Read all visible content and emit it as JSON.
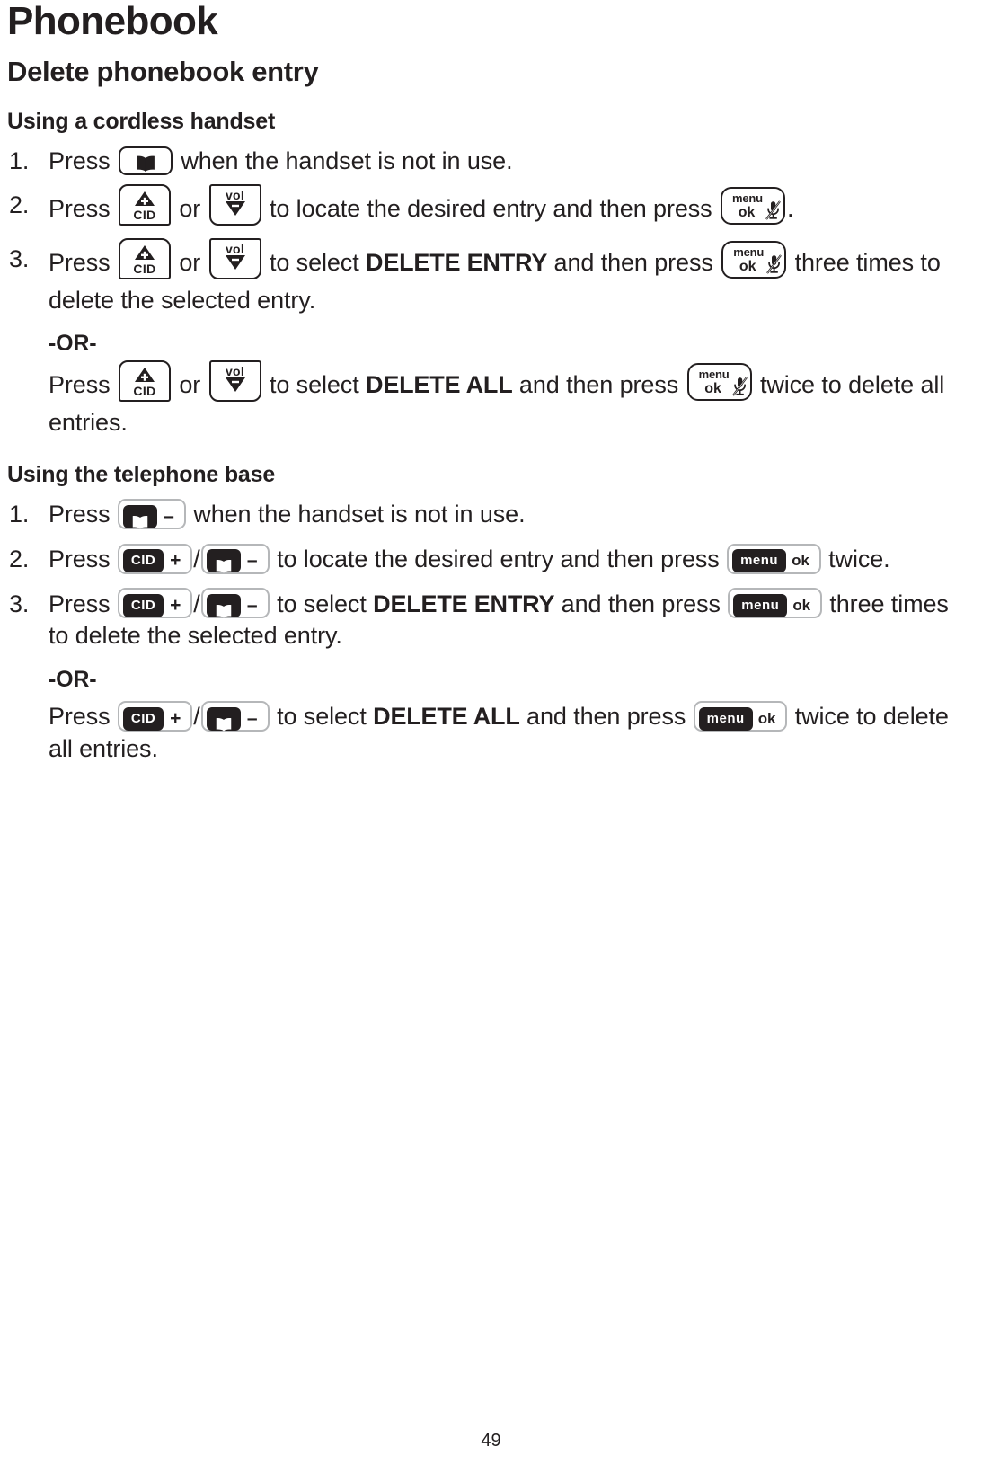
{
  "document": {
    "chapter_title": "Phonebook",
    "section_title": "Delete phonebook entry",
    "page_number": "49"
  },
  "keys": {
    "handset_phonebook": {
      "icon": "open-book-icon",
      "label": ""
    },
    "handset_cid_up": {
      "sign": "+",
      "label": "CID"
    },
    "handset_vol_down": {
      "sign": "–",
      "label": "vol"
    },
    "handset_menu_ok": {
      "line1": "menu",
      "line2": "ok",
      "icon": "muted-microphone-icon"
    },
    "base_phonebook": {
      "icon": "open-book-icon",
      "sign": "–"
    },
    "base_cid": {
      "label": "CID",
      "sign": "+"
    },
    "base_menu_ok": {
      "label": "menu",
      "ok": "ok"
    }
  },
  "cordless": {
    "heading": "Using a cordless handset",
    "steps": [
      {
        "num": "1.",
        "parts": [
          {
            "t": "text",
            "v": "Press "
          },
          {
            "t": "key",
            "v": "handset_phonebook"
          },
          {
            "t": "text",
            "v": " when the handset is not in use."
          }
        ]
      },
      {
        "num": "2.",
        "parts": [
          {
            "t": "text",
            "v": "Press "
          },
          {
            "t": "key",
            "v": "handset_cid_up"
          },
          {
            "t": "text",
            "v": " or "
          },
          {
            "t": "key",
            "v": "handset_vol_down"
          },
          {
            "t": "text",
            "v": " to locate the desired entry and then press "
          },
          {
            "t": "key",
            "v": "handset_menu_ok"
          },
          {
            "t": "text",
            "v": "."
          }
        ]
      },
      {
        "num": "3.",
        "parts": [
          {
            "t": "text",
            "v": "Press "
          },
          {
            "t": "key",
            "v": "handset_cid_up"
          },
          {
            "t": "text",
            "v": " or "
          },
          {
            "t": "key",
            "v": "handset_vol_down"
          },
          {
            "t": "text",
            "v": " to select "
          },
          {
            "t": "strong",
            "v": "DELETE ENTRY"
          },
          {
            "t": "text",
            "v": " and then press "
          },
          {
            "t": "key",
            "v": "handset_menu_ok"
          },
          {
            "t": "text",
            "v": " three times to delete the selected entry."
          }
        ],
        "or_label": "-OR-",
        "or_parts": [
          {
            "t": "text",
            "v": "Press "
          },
          {
            "t": "key",
            "v": "handset_cid_up"
          },
          {
            "t": "text",
            "v": " or "
          },
          {
            "t": "key",
            "v": "handset_vol_down"
          },
          {
            "t": "text",
            "v": " to select "
          },
          {
            "t": "strong",
            "v": "DELETE ALL"
          },
          {
            "t": "text",
            "v": " and then press "
          },
          {
            "t": "key",
            "v": "handset_menu_ok"
          },
          {
            "t": "text",
            "v": " twice to delete all entries."
          }
        ]
      }
    ]
  },
  "base": {
    "heading": "Using the telephone base",
    "steps": [
      {
        "num": "1.",
        "parts": [
          {
            "t": "text",
            "v": "Press "
          },
          {
            "t": "key",
            "v": "base_phonebook"
          },
          {
            "t": "text",
            "v": " when the handset is not in use."
          }
        ]
      },
      {
        "num": "2.",
        "parts": [
          {
            "t": "text",
            "v": "Press "
          },
          {
            "t": "key",
            "v": "base_cid"
          },
          {
            "t": "text",
            "v": "/"
          },
          {
            "t": "key",
            "v": "base_phonebook"
          },
          {
            "t": "text",
            "v": " to locate the desired entry and then press "
          },
          {
            "t": "key",
            "v": "base_menu_ok"
          },
          {
            "t": "text",
            "v": " twice."
          }
        ]
      },
      {
        "num": "3.",
        "parts": [
          {
            "t": "text",
            "v": "Press "
          },
          {
            "t": "key",
            "v": "base_cid"
          },
          {
            "t": "text",
            "v": "/"
          },
          {
            "t": "key",
            "v": "base_phonebook"
          },
          {
            "t": "text",
            "v": " to select "
          },
          {
            "t": "strong",
            "v": "DELETE ENTRY"
          },
          {
            "t": "text",
            "v": " and then press "
          },
          {
            "t": "key",
            "v": "base_menu_ok"
          },
          {
            "t": "text",
            "v": " three times to delete the selected entry."
          }
        ],
        "or_label": "-OR-",
        "or_parts": [
          {
            "t": "text",
            "v": "Press "
          },
          {
            "t": "key",
            "v": "base_cid"
          },
          {
            "t": "text",
            "v": "/"
          },
          {
            "t": "key",
            "v": "base_phonebook"
          },
          {
            "t": "text",
            "v": " to select "
          },
          {
            "t": "strong",
            "v": "DELETE ALL"
          },
          {
            "t": "text",
            "v": " and then press "
          },
          {
            "t": "key",
            "v": "base_menu_ok"
          },
          {
            "t": "text",
            "v": " twice to delete all entries."
          }
        ]
      }
    ]
  }
}
